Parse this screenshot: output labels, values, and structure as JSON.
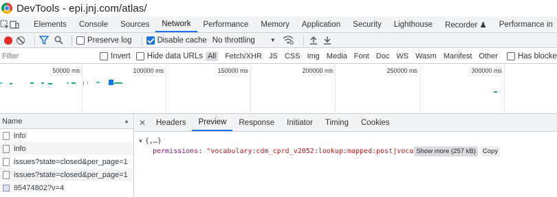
{
  "window": {
    "title": "DevTools - epi.jnj.com/atlas/"
  },
  "main_tabs": [
    {
      "label": "Elements"
    },
    {
      "label": "Console"
    },
    {
      "label": "Sources"
    },
    {
      "label": "Network"
    },
    {
      "label": "Performance"
    },
    {
      "label": "Memory"
    },
    {
      "label": "Application"
    },
    {
      "label": "Security"
    },
    {
      "label": "Lighthouse"
    },
    {
      "label": "Recorder ♟"
    },
    {
      "label": "Performance in"
    }
  ],
  "active_tab": "Network",
  "network_toolbar": {
    "preserve_log_label": "Preserve log",
    "preserve_log_checked": false,
    "disable_cache_label": "Disable cache",
    "disable_cache_checked": true,
    "throttling_value": "No throttling"
  },
  "filter_bar": {
    "filter_placeholder": "Filter",
    "invert_label": "Invert",
    "hide_data_urls_label": "Hide data URLs",
    "type_filters": [
      "All",
      "Fetch/XHR",
      "JS",
      "CSS",
      "Img",
      "Media",
      "Font",
      "Doc",
      "WS",
      "Wasm",
      "Manifest",
      "Other"
    ],
    "active_type": "All",
    "blocked_cookies_label": "Has blocked coo"
  },
  "overview": {
    "tick_labels": [
      "50000 ms",
      "100000 ms",
      "150000 ms",
      "200000 ms",
      "250000 ms",
      "300000 ms"
    ]
  },
  "request_list": {
    "header": "Name",
    "rows": [
      {
        "name": "info",
        "type": "doc"
      },
      {
        "name": "info",
        "type": "doc"
      },
      {
        "name": "issues?state=closed&per_page=1",
        "type": "doc"
      },
      {
        "name": "issues?state=closed&per_page=1",
        "type": "doc"
      },
      {
        "name": "95474802?v=4",
        "type": "img"
      }
    ]
  },
  "detail": {
    "tabs": [
      "Headers",
      "Preview",
      "Response",
      "Initiator",
      "Timing",
      "Cookies"
    ],
    "active_tab": "Preview",
    "preview": {
      "root": "{,…}",
      "key": "permissions",
      "value": "\"vocabulary:cdm_cprd_v2052:lookup:mapped:post|voca",
      "show_more_label": "Show more (257 kB)",
      "copy_label": "Copy"
    }
  },
  "colors": {
    "accent": "#1a73e8",
    "record": "#e32d2d",
    "key": "#881280",
    "string": "#c41a16"
  }
}
